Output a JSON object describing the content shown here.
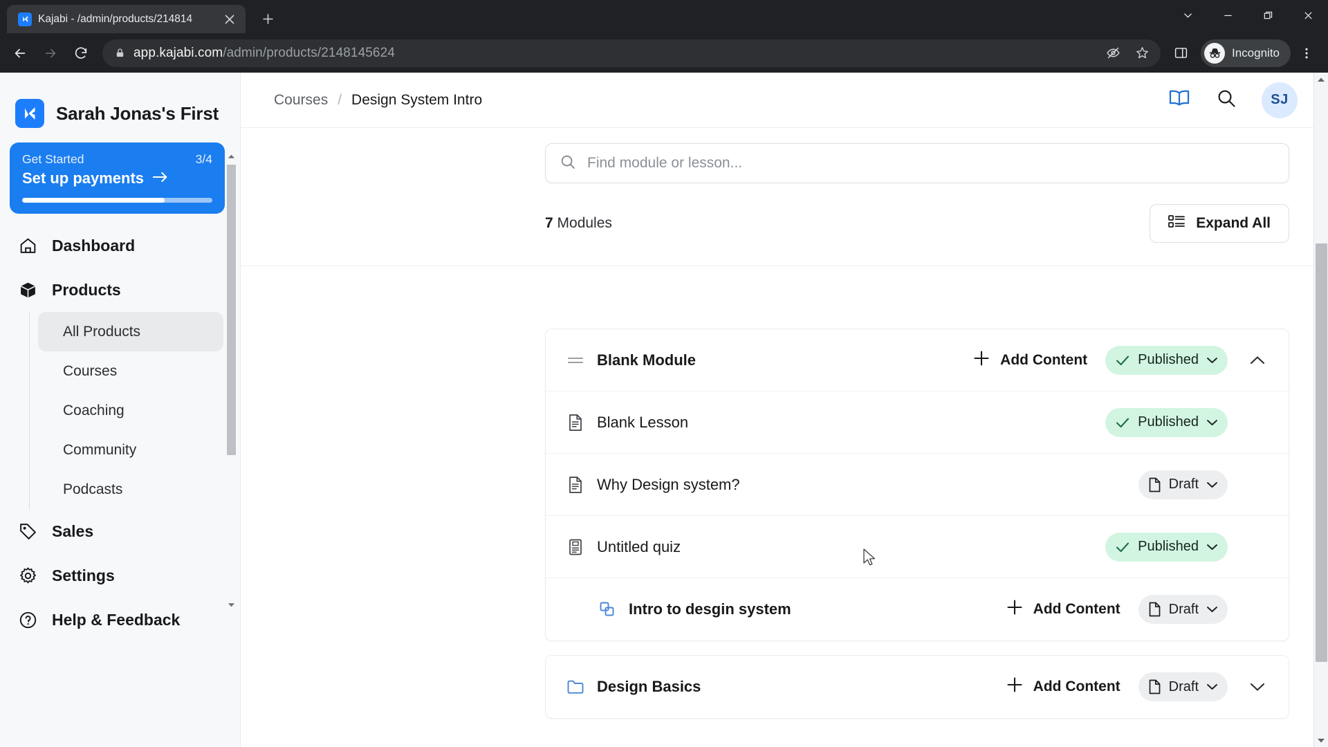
{
  "browser": {
    "tab": {
      "title": "Kajabi - /admin/products/214814",
      "favicon_icon": "kajabi-logo-icon",
      "close_icon": "close-icon"
    },
    "newtab_icon": "plus-icon",
    "window_controls": [
      {
        "name": "tab-search",
        "icon": "chevron-down-icon"
      },
      {
        "name": "minimize",
        "icon": "minimize-icon"
      },
      {
        "name": "maximize",
        "icon": "restore-icon"
      },
      {
        "name": "close",
        "icon": "close-icon"
      }
    ],
    "nav": {
      "back_icon": "arrow-left-icon",
      "forward_icon": "arrow-right-icon",
      "reload_icon": "reload-icon"
    },
    "omnibox": {
      "lock_icon": "lock-icon",
      "host": "app.kajabi.com",
      "path": "/admin/products/2148145624",
      "tracking_protection_icon": "eye-off-icon",
      "bookmark_icon": "star-icon"
    },
    "side_panel_icon": "side-panel-icon",
    "profile": {
      "label": "Incognito",
      "icon": "incognito-icon"
    },
    "menu_icon": "three-dots-icon"
  },
  "sidebar": {
    "brand": {
      "name": "Sarah Jonas's First",
      "logo_icon": "kajabi-logo-icon"
    },
    "get_started": {
      "label": "Get Started",
      "count": "3/4",
      "action": "Set up payments",
      "arrow_icon": "arrow-right-icon",
      "progress_percent": 75,
      "bg_color": "#1a7df0"
    },
    "nav": [
      {
        "label": "Dashboard",
        "icon": "home-icon"
      },
      {
        "label": "Products",
        "icon": "box-icon"
      }
    ],
    "subnav": [
      {
        "label": "All Products",
        "active": true
      },
      {
        "label": "Courses",
        "active": false
      },
      {
        "label": "Coaching",
        "active": false
      },
      {
        "label": "Community",
        "active": false
      },
      {
        "label": "Podcasts",
        "active": false
      }
    ],
    "nav_bottom": [
      {
        "label": "Sales",
        "icon": "tag-icon"
      },
      {
        "label": "Settings",
        "icon": "gear-icon"
      },
      {
        "label": "Help & Feedback",
        "icon": "question-circle-icon"
      }
    ]
  },
  "header": {
    "breadcrumb": {
      "parent": "Courses",
      "separator": "/",
      "current": "Design System Intro"
    },
    "book_icon": "book-icon",
    "search_icon": "search-icon",
    "avatar_initials": "SJ",
    "avatar_bg": "#dbeafe"
  },
  "content": {
    "search": {
      "placeholder": "Find module or lesson...",
      "value": "",
      "icon": "search-icon"
    },
    "module_count_number": "7",
    "module_count_label": "Modules",
    "expand_all": {
      "label": "Expand All",
      "icon": "list-expand-icon"
    },
    "add_content_label": "Add Content",
    "add_content_icon": "plus-icon",
    "rows": [
      {
        "title": "Blank Module",
        "icon": "drag-handle-icon",
        "bold": true,
        "indent": false,
        "add_content": true,
        "status": "Published",
        "status_type": "published",
        "status_icon": "check-icon",
        "collapse_icon": "chevron-up-icon"
      },
      {
        "title": "Blank Lesson",
        "icon": "document-icon",
        "bold": false,
        "indent": false,
        "add_content": false,
        "status": "Published",
        "status_type": "published",
        "status_icon": "check-icon",
        "collapse_icon": ""
      },
      {
        "title": "Why Design system?",
        "icon": "document-icon",
        "bold": false,
        "indent": false,
        "add_content": false,
        "status": "Draft",
        "status_type": "draft",
        "status_icon": "file-icon",
        "collapse_icon": ""
      },
      {
        "title": "Untitled quiz",
        "icon": "quiz-icon",
        "bold": false,
        "indent": false,
        "add_content": false,
        "status": "Published",
        "status_type": "published",
        "status_icon": "check-icon",
        "collapse_icon": ""
      },
      {
        "title": "Intro to desgin system",
        "icon": "duplicate-icon",
        "bold": true,
        "indent": true,
        "add_content": true,
        "status": "Draft",
        "status_type": "draft",
        "status_icon": "file-icon",
        "collapse_icon": ""
      }
    ],
    "rows2": [
      {
        "title": "Design Basics",
        "icon": "folder-icon",
        "bold": true,
        "indent": false,
        "add_content": true,
        "status": "Draft",
        "status_type": "draft",
        "status_icon": "file-icon",
        "collapse_icon": "chevron-down-icon"
      }
    ],
    "status_colors": {
      "published_bg": "#d2f5e1",
      "draft_bg": "#eceef0"
    }
  }
}
